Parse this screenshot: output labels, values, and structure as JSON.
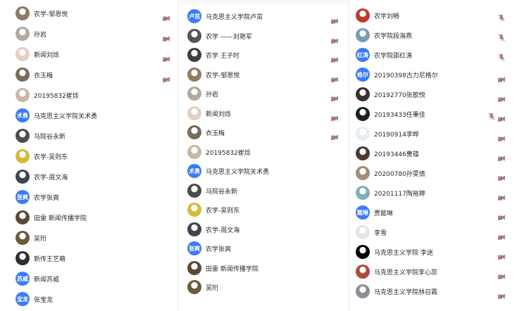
{
  "accent": "#3a7bf6",
  "column1": [
    {
      "name": "农学-邹恩悦",
      "avatar": {
        "kind": "photo",
        "color": "#8f7a64"
      },
      "cam": true
    },
    {
      "name": "孙岩",
      "avatar": {
        "kind": "photo",
        "color": "#b3a9a0"
      },
      "cam": true
    },
    {
      "name": "新闻刘烁",
      "avatar": {
        "kind": "photo",
        "color": "#e5cfc0"
      },
      "cam": true
    },
    {
      "name": "衣玉梅",
      "avatar": {
        "kind": "photo",
        "color": "#7c6a5a"
      },
      "cam": true
    },
    {
      "name": "20195832崔烁",
      "avatar": {
        "kind": "photo",
        "color": "#c9b7a6"
      },
      "cam": false
    },
    {
      "name": "马克思主义学院关术勇",
      "avatar": {
        "kind": "text",
        "text": "术勇"
      },
      "cam": false
    },
    {
      "name": "马院谷永新",
      "avatar": {
        "kind": "photo",
        "color": "#4d4d4d"
      },
      "cam": false
    },
    {
      "name": "农学-吴则东",
      "avatar": {
        "kind": "photo",
        "color": "#d6b93a"
      },
      "cam": false
    },
    {
      "name": "农学-周文海",
      "avatar": {
        "kind": "photo",
        "color": "#40464f"
      },
      "cam": false
    },
    {
      "name": "农学张爽",
      "avatar": {
        "kind": "text",
        "text": "张爽"
      },
      "cam": false
    },
    {
      "name": "田雷 新闻传播学院",
      "avatar": {
        "kind": "photo",
        "color": "#5a4a34"
      },
      "cam": false
    },
    {
      "name": "吴珩",
      "avatar": {
        "kind": "photo",
        "color": "#6d5a3c"
      },
      "cam": false
    },
    {
      "name": "新传王艺萌",
      "avatar": {
        "kind": "photo",
        "color": "#2e2e2e"
      },
      "cam": false
    },
    {
      "name": "新闻苏威",
      "avatar": {
        "kind": "text",
        "text": "苏威"
      },
      "cam": false
    },
    {
      "name": "张宝龙",
      "avatar": {
        "kind": "text",
        "text": "宝龙"
      },
      "cam": false
    }
  ],
  "column2": [
    {
      "name": "马克思主义学院卢茁",
      "avatar": {
        "kind": "text",
        "text": "卢茁"
      },
      "cam": true
    },
    {
      "name": "农学 ——刘艳军",
      "avatar": {
        "kind": "photo",
        "color": "#555"
      },
      "cam": true
    },
    {
      "name": "农学 王子时",
      "avatar": {
        "kind": "photo",
        "color": "#3e3e3e"
      },
      "cam": true
    },
    {
      "name": "农学-邹恩悦",
      "avatar": {
        "kind": "photo",
        "color": "#8f7a64"
      },
      "cam": true
    },
    {
      "name": "孙岩",
      "avatar": {
        "kind": "photo",
        "color": "#b3a9a0"
      },
      "cam": true
    },
    {
      "name": "新闻刘烁",
      "avatar": {
        "kind": "photo",
        "color": "#e5cfc0"
      },
      "cam": true
    },
    {
      "name": "衣玉梅",
      "avatar": {
        "kind": "photo",
        "color": "#7c6a5a"
      },
      "cam": true
    },
    {
      "name": "20195832崔烁",
      "avatar": {
        "kind": "photo",
        "color": "#c9b7a6"
      },
      "cam": false
    },
    {
      "name": "马克思主义学院关术勇",
      "avatar": {
        "kind": "text",
        "text": "术勇"
      },
      "cam": false
    },
    {
      "name": "马院谷永新",
      "avatar": {
        "kind": "photo",
        "color": "#4d4d4d"
      },
      "cam": false
    },
    {
      "name": "农学-吴则东",
      "avatar": {
        "kind": "photo",
        "color": "#d6b93a"
      },
      "cam": false
    },
    {
      "name": "农学-周文海",
      "avatar": {
        "kind": "photo",
        "color": "#40464f"
      },
      "cam": false
    },
    {
      "name": "农学张爽",
      "avatar": {
        "kind": "text",
        "text": "张爽"
      },
      "cam": false
    },
    {
      "name": "田雷 新闻传播学院",
      "avatar": {
        "kind": "photo",
        "color": "#5a4a34"
      },
      "cam": false
    },
    {
      "name": "吴珩",
      "avatar": {
        "kind": "photo",
        "color": "#6d5a3c"
      },
      "cam": false
    }
  ],
  "column3": [
    {
      "name": "农学刘畅",
      "avatar": {
        "kind": "photo",
        "color": "#c03a2b"
      },
      "cam": false,
      "mic": true
    },
    {
      "name": "农学院段海燕",
      "avatar": {
        "kind": "photo",
        "color": "#7a9bb5"
      },
      "cam": false,
      "mic": true
    },
    {
      "name": "农学院邵红涛",
      "avatar": {
        "kind": "text",
        "text": "红涛"
      },
      "cam": false,
      "mic": true
    },
    {
      "name": "20190398古力尼格尔",
      "avatar": {
        "kind": "text",
        "text": "格尔"
      },
      "cam": true,
      "mic": false
    },
    {
      "name": "20192770张歆悦",
      "avatar": {
        "kind": "photo",
        "color": "#3a3030"
      },
      "cam": true,
      "mic": false
    },
    {
      "name": "20193433任秉佳",
      "avatar": {
        "kind": "photo",
        "color": "#1f1f1f"
      },
      "cam": true,
      "mic": true
    },
    {
      "name": "20190914李晔",
      "avatar": {
        "kind": "photo",
        "color": "#e8eef2"
      },
      "cam": true,
      "mic": false
    },
    {
      "name": "20193446曹蕴",
      "avatar": {
        "kind": "photo",
        "color": "#4a3a32"
      },
      "cam": true,
      "mic": false
    },
    {
      "name": "20200780孙雯倩",
      "avatar": {
        "kind": "photo",
        "color": "#a58a7a"
      },
      "cam": true,
      "mic": false
    },
    {
      "name": "20201117陶裕婷",
      "avatar": {
        "kind": "photo",
        "color": "#7fb1b3"
      },
      "cam": true,
      "mic": false
    },
    {
      "name": "贾懿琳",
      "avatar": {
        "kind": "text",
        "text": "懿琳"
      },
      "cam": true,
      "mic": false
    },
    {
      "name": "李雪",
      "avatar": {
        "kind": "photo",
        "color": "#e6e6e6"
      },
      "cam": true,
      "mic": false
    },
    {
      "name": "马克思主义学院 李迷",
      "avatar": {
        "kind": "photo",
        "color": "#000000"
      },
      "cam": true,
      "mic": false
    },
    {
      "name": "马克思主义学院李心蕊",
      "avatar": {
        "kind": "photo",
        "color": "#b04a3a"
      },
      "cam": true,
      "mic": false
    },
    {
      "name": "马克思主义学院林召霞",
      "avatar": {
        "kind": "photo",
        "color": "#8a8e94"
      },
      "cam": true,
      "mic": false
    }
  ]
}
